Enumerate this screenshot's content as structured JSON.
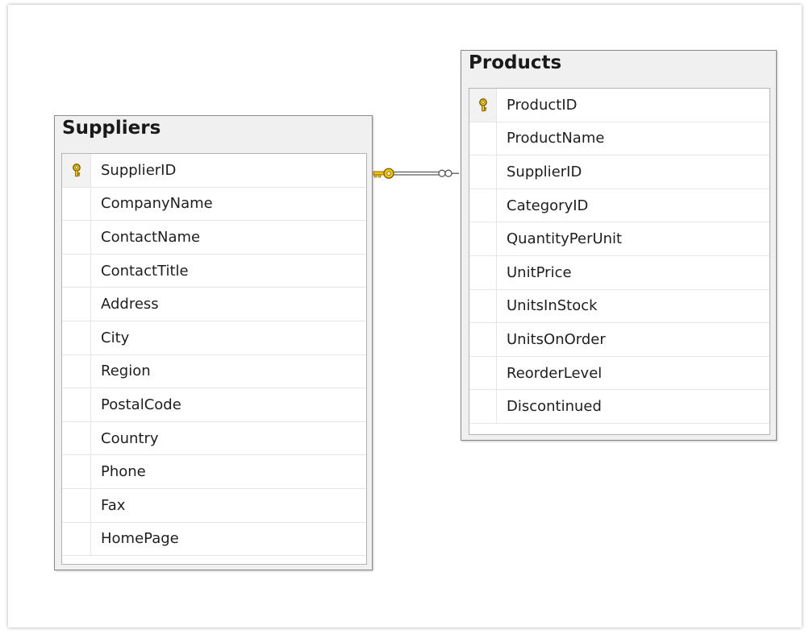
{
  "colors": {
    "key_gold": "#f5c400",
    "key_outline": "#6b5200",
    "relationship_line": "#5a5a5a"
  },
  "relationship": {
    "from_table": "Suppliers",
    "from_column": "SupplierID",
    "to_table": "Products",
    "to_column": "SupplierID",
    "cardinality": "one-to-many",
    "one_end_icon": "key-icon",
    "many_end_icon": "infinity-icon"
  },
  "tables": [
    {
      "title": "Suppliers",
      "primary_key": "SupplierID",
      "columns": [
        "SupplierID",
        "CompanyName",
        "ContactName",
        "ContactTitle",
        "Address",
        "City",
        "Region",
        "PostalCode",
        "Country",
        "Phone",
        "Fax",
        "HomePage"
      ]
    },
    {
      "title": "Products",
      "primary_key": "ProductID",
      "columns": [
        "ProductID",
        "ProductName",
        "SupplierID",
        "CategoryID",
        "QuantityPerUnit",
        "UnitPrice",
        "UnitsInStock",
        "UnitsOnOrder",
        "ReorderLevel",
        "Discontinued"
      ]
    }
  ]
}
